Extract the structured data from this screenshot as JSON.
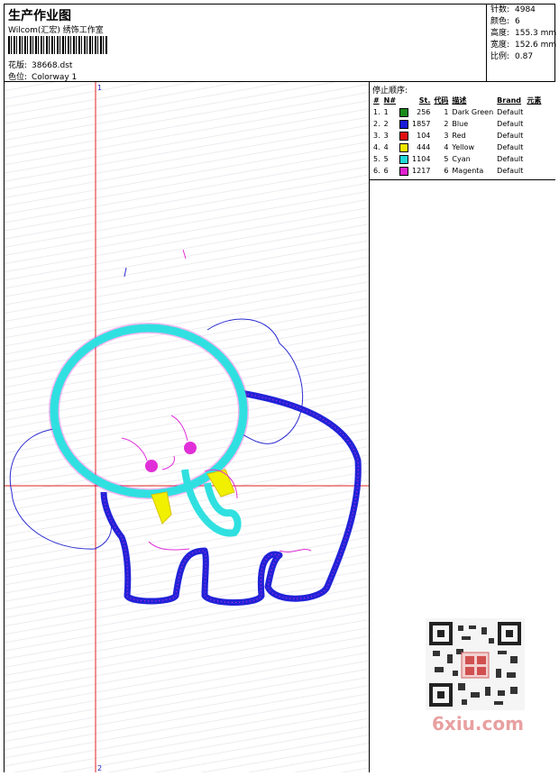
{
  "header": {
    "title": "生产作业图",
    "company": "Wilcom(汇宏) 绣饰工作室",
    "design_label": "花版:",
    "design_file": "38668.dst",
    "colorway_label": "色位:",
    "colorway": "Colorway 1"
  },
  "stats": [
    {
      "label": "针数:",
      "value": "4984"
    },
    {
      "label": "颜色:",
      "value": "6"
    },
    {
      "label": "高度:",
      "value": "155.3 mm"
    },
    {
      "label": "宽度:",
      "value": "152.6 mm"
    },
    {
      "label": "比例:",
      "value": "0.87"
    }
  ],
  "guides": {
    "v_label": "1",
    "h_label": "2"
  },
  "stop_sequence": {
    "title": "停止顺序:",
    "headers": [
      "#",
      "N#",
      "St.",
      "代码",
      "描述",
      "Brand",
      "元素"
    ],
    "rows": [
      {
        "idx": "1.",
        "n": "1",
        "color": "#1a8a1a",
        "st": "256",
        "code": "1",
        "desc": "Dark Green",
        "brand": "Default"
      },
      {
        "idx": "2.",
        "n": "2",
        "color": "#1a1ad8",
        "st": "1857",
        "code": "2",
        "desc": "Blue",
        "brand": "Default"
      },
      {
        "idx": "3.",
        "n": "3",
        "color": "#e01010",
        "st": "104",
        "code": "3",
        "desc": "Red",
        "brand": "Default"
      },
      {
        "idx": "4.",
        "n": "4",
        "color": "#f0e800",
        "st": "444",
        "code": "4",
        "desc": "Yellow",
        "brand": "Default"
      },
      {
        "idx": "5.",
        "n": "5",
        "color": "#20d8d8",
        "st": "1104",
        "code": "5",
        "desc": "Cyan",
        "brand": "Default"
      },
      {
        "idx": "6.",
        "n": "6",
        "color": "#e020d0",
        "st": "1217",
        "code": "6",
        "desc": "Magenta",
        "brand": "Default"
      }
    ]
  },
  "watermark": "6xiu.com",
  "colors": {
    "guide": "#e02020",
    "blue": "#2020e0",
    "cyan": "#30e0e0",
    "magenta": "#e030d8",
    "yellow": "#f0f000"
  }
}
